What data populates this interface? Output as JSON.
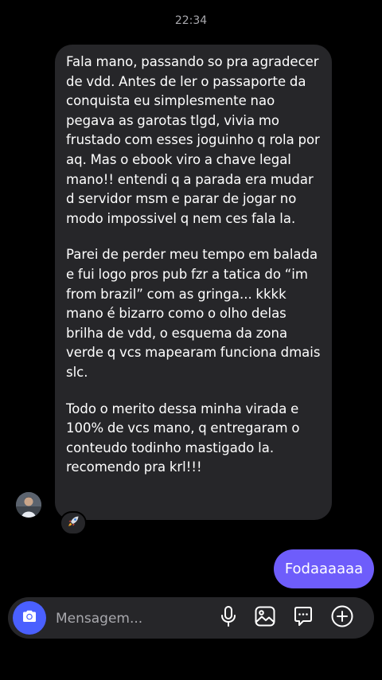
{
  "timestamp": "22:34",
  "incoming_message": {
    "paragraphs": [
      "Fala mano, passando so pra agradecer de vdd. Antes de ler o passaporte da conquista eu simplesmente nao pegava as garotas tlgd, vivia mo frustado com esses joguinho q rola por aq. Mas o ebook viro a chave legal mano!! entendi q a parada era mudar d servidor msm e parar de jogar no modo impossivel q nem ces fala la.",
      "Parei de perder meu tempo em balada e fui logo pros pub fzr a tatica do “im from brazil” com as gringa... kkkk mano é bizarro como o olho delas brilha de vdd, o esquema da zona verde q vcs mapearam funciona dmais slc.",
      "Todo o merito dessa minha virada e 100% de vcs mano, q entregaram o conteudo todinho mastigado la. recomendo pra krl!!!"
    ],
    "reaction_icon": "rocket-emoji"
  },
  "outgoing_message": {
    "text": "Fodaaaaaa"
  },
  "composer": {
    "placeholder": "Mensagem...",
    "icons": [
      "camera-icon",
      "microphone-icon",
      "image-icon",
      "sticker-chat-icon",
      "add-icon"
    ]
  },
  "colors": {
    "background": "#000000",
    "incoming_bubble": "#262629",
    "outgoing_bubble": "#6e5dfb",
    "camera_button": "#4a60ff",
    "secondary_text": "#a8a8ad"
  }
}
